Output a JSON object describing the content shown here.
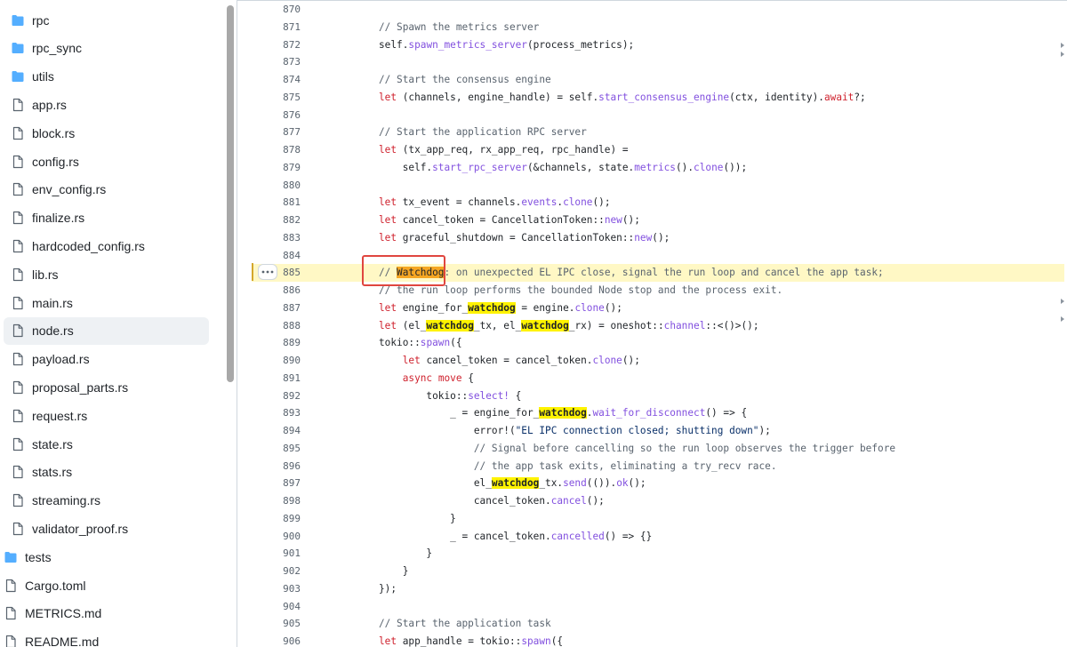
{
  "sidebar": {
    "items": [
      {
        "label": "rpc",
        "type": "folder"
      },
      {
        "label": "rpc_sync",
        "type": "folder"
      },
      {
        "label": "utils",
        "type": "folder"
      },
      {
        "label": "app.rs",
        "type": "file"
      },
      {
        "label": "block.rs",
        "type": "file"
      },
      {
        "label": "config.rs",
        "type": "file"
      },
      {
        "label": "env_config.rs",
        "type": "file"
      },
      {
        "label": "finalize.rs",
        "type": "file"
      },
      {
        "label": "hardcoded_config.rs",
        "type": "file"
      },
      {
        "label": "lib.rs",
        "type": "file"
      },
      {
        "label": "main.rs",
        "type": "file"
      },
      {
        "label": "node.rs",
        "type": "file",
        "selected": true
      },
      {
        "label": "payload.rs",
        "type": "file"
      },
      {
        "label": "proposal_parts.rs",
        "type": "file"
      },
      {
        "label": "request.rs",
        "type": "file"
      },
      {
        "label": "state.rs",
        "type": "file"
      },
      {
        "label": "stats.rs",
        "type": "file"
      },
      {
        "label": "streaming.rs",
        "type": "file"
      },
      {
        "label": "validator_proof.rs",
        "type": "file"
      },
      {
        "label": "tests",
        "type": "folder",
        "depth": 0
      },
      {
        "label": "Cargo.toml",
        "type": "file",
        "depth": 0
      },
      {
        "label": "METRICS.md",
        "type": "file",
        "depth": 0
      },
      {
        "label": "README.md",
        "type": "file",
        "depth": 0
      }
    ]
  },
  "code": {
    "highlighted_line": 885,
    "search_term": "watchdog",
    "lines": [
      {
        "n": "870",
        "t": ""
      },
      {
        "n": "871",
        "t": "            // Spawn the metrics server"
      },
      {
        "n": "872",
        "t": "            self.spawn_metrics_server(process_metrics);"
      },
      {
        "n": "873",
        "t": ""
      },
      {
        "n": "874",
        "t": "            // Start the consensus engine"
      },
      {
        "n": "875",
        "t": "            let (channels, engine_handle) = self.start_consensus_engine(ctx, identity).await?;"
      },
      {
        "n": "876",
        "t": ""
      },
      {
        "n": "877",
        "t": "            // Start the application RPC server"
      },
      {
        "n": "878",
        "t": "            let (tx_app_req, rx_app_req, rpc_handle) ="
      },
      {
        "n": "879",
        "t": "                self.start_rpc_server(&channels, state.metrics().clone());"
      },
      {
        "n": "880",
        "t": ""
      },
      {
        "n": "881",
        "t": "            let tx_event = channels.events.clone();"
      },
      {
        "n": "882",
        "t": "            let cancel_token = CancellationToken::new();"
      },
      {
        "n": "883",
        "t": "            let graceful_shutdown = CancellationToken::new();"
      },
      {
        "n": "884",
        "t": ""
      },
      {
        "n": "885",
        "t": "            // Watchdog: on unexpected EL IPC close, signal the run loop and cancel the app task;"
      },
      {
        "n": "886",
        "t": "            // the run loop performs the bounded Node stop and the process exit."
      },
      {
        "n": "887",
        "t": "            let engine_for_watchdog = engine.clone();"
      },
      {
        "n": "888",
        "t": "            let (el_watchdog_tx, el_watchdog_rx) = oneshot::channel::<()>();"
      },
      {
        "n": "889",
        "t": "            tokio::spawn({"
      },
      {
        "n": "890",
        "t": "                let cancel_token = cancel_token.clone();"
      },
      {
        "n": "891",
        "t": "                async move {"
      },
      {
        "n": "892",
        "t": "                    tokio::select! {"
      },
      {
        "n": "893",
        "t": "                        _ = engine_for_watchdog.wait_for_disconnect() => {"
      },
      {
        "n": "894",
        "t": "                            error!(\"EL IPC connection closed; shutting down\");"
      },
      {
        "n": "895",
        "t": "                            // Signal before cancelling so the run loop observes the trigger before"
      },
      {
        "n": "896",
        "t": "                            // the app task exits, eliminating a try_recv race."
      },
      {
        "n": "897",
        "t": "                            el_watchdog_tx.send(()).ok();"
      },
      {
        "n": "898",
        "t": "                            cancel_token.cancel();"
      },
      {
        "n": "899",
        "t": "                        }"
      },
      {
        "n": "900",
        "t": "                        _ = cancel_token.cancelled() => {}"
      },
      {
        "n": "901",
        "t": "                    }"
      },
      {
        "n": "902",
        "t": "                }"
      },
      {
        "n": "903",
        "t": "            });"
      },
      {
        "n": "904",
        "t": ""
      },
      {
        "n": "905",
        "t": "            // Start the application task"
      },
      {
        "n": "906",
        "t": "            let app_handle = tokio::spawn({"
      }
    ]
  },
  "icons": {
    "folder": "folder-icon",
    "file": "file-icon",
    "line_menu": "kebab-icon"
  },
  "colors": {
    "folder": "#54aeff",
    "highlight_line": "#fff8c5",
    "search_match": "#fff300",
    "focus_box": "#e0463f",
    "keyword": "#cf222e",
    "function": "#8250df",
    "comment": "#59636e"
  }
}
